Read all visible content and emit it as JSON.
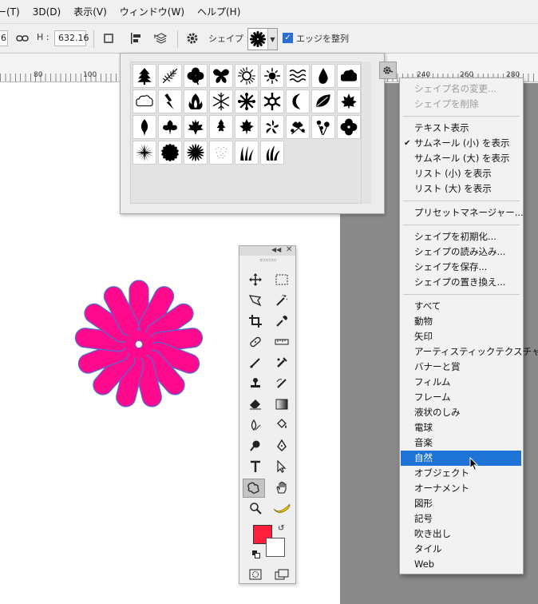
{
  "menubar": {
    "items": [
      "ー(T)",
      "3D(D)",
      "表示(V)",
      "ウィンドウ(W)",
      "ヘルプ(H)"
    ]
  },
  "options": {
    "w_value": "6",
    "h_label": "H :",
    "h_value": "632.16",
    "shape_label": "シェイプ :",
    "align_edges_label": "エッジを整列"
  },
  "ruler": {
    "left_labels": [
      "80",
      "100"
    ],
    "right_labels": [
      "240",
      "260",
      "280"
    ]
  },
  "context_menu": {
    "items": [
      {
        "label": "シェイプ名の変更...",
        "disabled": true
      },
      {
        "label": "シェイプを削除",
        "disabled": true
      },
      {
        "label": "テキスト表示"
      },
      {
        "label": "サムネール (小) を表示",
        "checked": true
      },
      {
        "label": "サムネール (大) を表示"
      },
      {
        "label": "リスト (小) を表示"
      },
      {
        "label": "リスト (大) を表示"
      },
      {
        "label": "プリセットマネージャー..."
      },
      {
        "label": "シェイプを初期化..."
      },
      {
        "label": "シェイプの読み込み..."
      },
      {
        "label": "シェイプを保存..."
      },
      {
        "label": "シェイプの置き換え..."
      },
      {
        "label": "すべて"
      },
      {
        "label": "動物"
      },
      {
        "label": "矢印"
      },
      {
        "label": "アーティスティックテクスチャ"
      },
      {
        "label": "バナーと賞"
      },
      {
        "label": "フィルム"
      },
      {
        "label": "フレーム"
      },
      {
        "label": "液状のしみ"
      },
      {
        "label": "電球"
      },
      {
        "label": "音楽"
      },
      {
        "label": "自然",
        "highlighted": true
      },
      {
        "label": "オブジェクト"
      },
      {
        "label": "オーナメント"
      },
      {
        "label": "図形"
      },
      {
        "label": "記号"
      },
      {
        "label": "吹き出し"
      },
      {
        "label": "タイル"
      },
      {
        "label": "Web"
      }
    ]
  },
  "shapes": [
    "tree-icon",
    "fern-icon",
    "clover-icon",
    "butterfly-icon",
    "sun-icon",
    "sun-small-icon",
    "waves-icon",
    "raindrop-icon",
    "cloud-icon",
    "cloud-outline-icon",
    "lightning-icon",
    "fire-icon",
    "snowflake-icon",
    "snowflake-2-icon",
    "snowflake-3-icon",
    "moon-icon",
    "leaf-icon",
    "maple-leaf-icon",
    "leaf-2-icon",
    "leaf-3-icon",
    "maple-leaf-2-icon",
    "leaf-4-icon",
    "leaf-5-icon",
    "flower-icon",
    "flower-2-icon",
    "flower-3-icon",
    "flower-4-icon",
    "starburst-icon",
    "daisy-icon",
    "daisy-2-icon",
    "grass-dots-icon",
    "grass-icon",
    "grass-2-icon"
  ],
  "colors": {
    "flower_fill": "#ff0a8c",
    "flower_stroke": "#4a6fd6",
    "foreground": "#ff1e3c",
    "background": "#ffffff",
    "highlight": "#1e73d6"
  }
}
